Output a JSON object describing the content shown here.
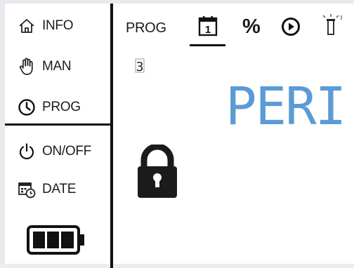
{
  "sidebar": {
    "items": [
      {
        "label": "INFO",
        "icon": "home-icon"
      },
      {
        "label": "MAN",
        "icon": "hand-icon"
      },
      {
        "label": "PROG",
        "icon": "clock-icon"
      },
      {
        "label": "ON/OFF",
        "icon": "power-icon"
      },
      {
        "label": "DATE",
        "icon": "calendar-clock-icon"
      }
    ],
    "battery": {
      "icon": "battery-icon",
      "level": 1.0
    }
  },
  "main": {
    "tabs": [
      {
        "label": "PROG",
        "icon": ""
      },
      {
        "label": "",
        "icon": "calendar-icon",
        "value": "1",
        "selected": true
      },
      {
        "label": "%",
        "icon": ""
      },
      {
        "label": "",
        "icon": "play-icon"
      },
      {
        "label": "",
        "icon": "sprinkler-icon"
      }
    ],
    "small_display": "3",
    "segment_display": "PERI",
    "segment_color": "#5b9bd5",
    "lock": {
      "icon": "lock-icon"
    }
  }
}
